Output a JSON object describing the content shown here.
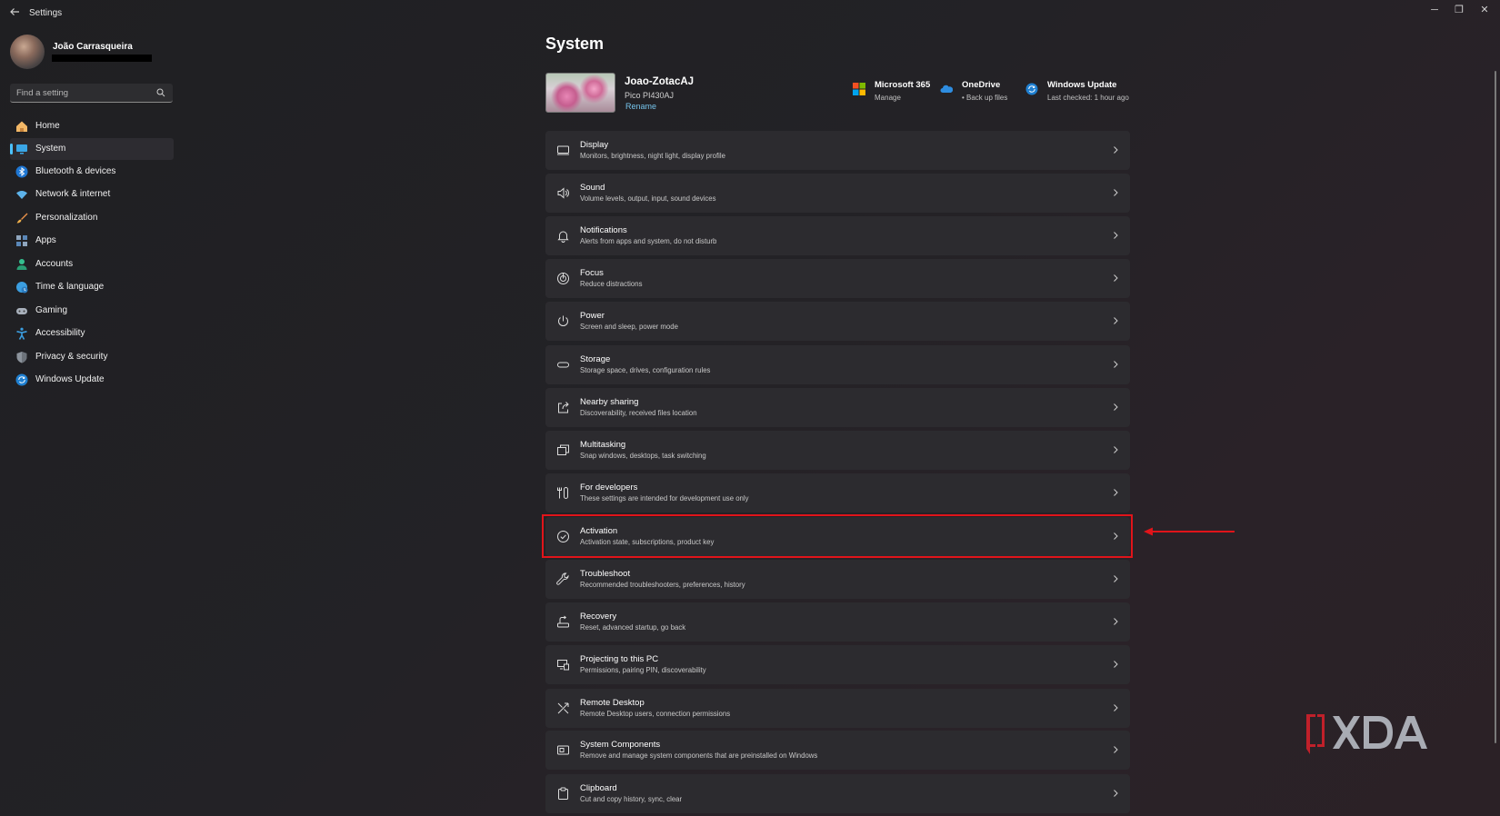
{
  "window": {
    "title": "Settings",
    "minimize": "─",
    "maximize": "❐",
    "close": "✕"
  },
  "user": {
    "name": "João Carrasqueira"
  },
  "search": {
    "placeholder": "Find a setting"
  },
  "sidebar": {
    "items": [
      {
        "label": "Home",
        "icon": "home-icon",
        "active": false
      },
      {
        "label": "System",
        "icon": "system-icon",
        "active": true
      },
      {
        "label": "Bluetooth & devices",
        "icon": "bluetooth-icon",
        "active": false
      },
      {
        "label": "Network & internet",
        "icon": "wifi-icon",
        "active": false
      },
      {
        "label": "Personalization",
        "icon": "brush-icon",
        "active": false
      },
      {
        "label": "Apps",
        "icon": "apps-icon",
        "active": false
      },
      {
        "label": "Accounts",
        "icon": "accounts-icon",
        "active": false
      },
      {
        "label": "Time & language",
        "icon": "globe-icon",
        "active": false
      },
      {
        "label": "Gaming",
        "icon": "gamepad-icon",
        "active": false
      },
      {
        "label": "Accessibility",
        "icon": "accessibility-icon",
        "active": false
      },
      {
        "label": "Privacy & security",
        "icon": "shield-icon",
        "active": false
      },
      {
        "label": "Windows Update",
        "icon": "update-icon",
        "active": false
      }
    ]
  },
  "main": {
    "title": "System",
    "device": {
      "name": "Joao-ZotacAJ",
      "model": "Pico PI430AJ",
      "rename": "Rename"
    },
    "quick_links": [
      {
        "title": "Microsoft 365",
        "subtitle": "Manage",
        "icon": "microsoft-365-icon"
      },
      {
        "title": "OneDrive",
        "subtitle": "• Back up files",
        "icon": "onedrive-icon"
      },
      {
        "title": "Windows Update",
        "subtitle": "Last checked: 1 hour ago",
        "icon": "windows-update-icon"
      }
    ],
    "settings": [
      {
        "title": "Display",
        "subtitle": "Monitors, brightness, night light, display profile",
        "icon": "display-icon"
      },
      {
        "title": "Sound",
        "subtitle": "Volume levels, output, input, sound devices",
        "icon": "sound-icon"
      },
      {
        "title": "Notifications",
        "subtitle": "Alerts from apps and system, do not disturb",
        "icon": "bell-icon"
      },
      {
        "title": "Focus",
        "subtitle": "Reduce distractions",
        "icon": "focus-icon"
      },
      {
        "title": "Power",
        "subtitle": "Screen and sleep, power mode",
        "icon": "power-icon"
      },
      {
        "title": "Storage",
        "subtitle": "Storage space, drives, configuration rules",
        "icon": "storage-icon"
      },
      {
        "title": "Nearby sharing",
        "subtitle": "Discoverability, received files location",
        "icon": "share-icon"
      },
      {
        "title": "Multitasking",
        "subtitle": "Snap windows, desktops, task switching",
        "icon": "multitasking-icon"
      },
      {
        "title": "For developers",
        "subtitle": "These settings are intended for development use only",
        "icon": "developer-icon"
      },
      {
        "title": "Activation",
        "subtitle": "Activation state, subscriptions, product key",
        "icon": "check-circle-icon"
      },
      {
        "title": "Troubleshoot",
        "subtitle": "Recommended troubleshooters, preferences, history",
        "icon": "wrench-icon"
      },
      {
        "title": "Recovery",
        "subtitle": "Reset, advanced startup, go back",
        "icon": "recovery-icon"
      },
      {
        "title": "Projecting to this PC",
        "subtitle": "Permissions, pairing PIN, discoverability",
        "icon": "projecting-icon"
      },
      {
        "title": "Remote Desktop",
        "subtitle": "Remote Desktop users, connection permissions",
        "icon": "remote-desktop-icon"
      },
      {
        "title": "System Components",
        "subtitle": "Remove and manage system components that are preinstalled on Windows",
        "icon": "components-icon"
      },
      {
        "title": "Clipboard",
        "subtitle": "Cut and copy history, sync, clear",
        "icon": "clipboard-icon"
      }
    ]
  },
  "annotation": {
    "highlighted_item": "Activation",
    "color": "#e1141a"
  },
  "colors": {
    "accent": "#4cc2ff",
    "link": "#76c4ec"
  }
}
